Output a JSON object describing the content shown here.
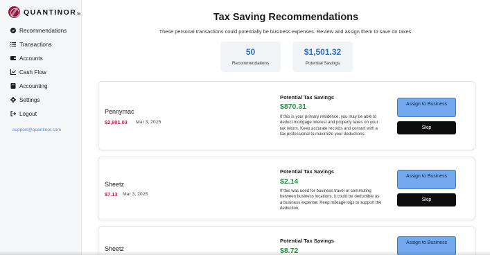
{
  "brand": {
    "name": "QUANTINOR",
    "suffix": "fc"
  },
  "sidebar": {
    "items": [
      {
        "label": "Recommendations",
        "icon": "check-circle-icon"
      },
      {
        "label": "Transactions",
        "icon": "list-icon"
      },
      {
        "label": "Accounts",
        "icon": "wallet-icon"
      },
      {
        "label": "Cash Flow",
        "icon": "line-chart-icon"
      },
      {
        "label": "Accounting",
        "icon": "book-icon"
      },
      {
        "label": "Settings",
        "icon": "gear-icon"
      },
      {
        "label": "Logout",
        "icon": "logout-icon"
      }
    ],
    "support_email": "support@quantinor.com"
  },
  "header": {
    "title": "Tax Saving Recommendations",
    "subtitle": "These personal transactions could potentially be business expenses. Review and assign them to save on taxes."
  },
  "stats": [
    {
      "value": "50",
      "label": "Recommendations"
    },
    {
      "value": "$1,501.32",
      "label": "Potential Savings"
    }
  ],
  "recommendations": [
    {
      "merchant": "Pennymac",
      "amount": "$2,901.03",
      "date": "Mar 3, 2025",
      "savings_heading": "Potential Tax Savings",
      "savings_value": "$870.31",
      "description": "If this is your primary residence, you may be able to deduct mortgage interest and property taxes on your tax return. Keep accurate records and consult with a tax professional to maximize your deductions.",
      "assign_label": "Assign to Business",
      "skip_label": "Skip"
    },
    {
      "merchant": "Sheetz",
      "amount": "$7.13",
      "date": "Mar 3, 2025",
      "savings_heading": "Potential Tax Savings",
      "savings_value": "$2.14",
      "description": "If this was used for business travel or commuting between business locations, it could be deductible as a business expense. Keep mileage logs to support the deduction.",
      "assign_label": "Assign to Business",
      "skip_label": "Skip"
    },
    {
      "merchant": "Sheetz",
      "savings_heading": "Potential Tax Savings",
      "savings_value": "$8.72",
      "assign_label": "Assign to Business"
    }
  ],
  "colors": {
    "brand": "#8e1b3a",
    "amount": "#b3294e",
    "savings": "#23913f",
    "stat_value": "#2f6fb8",
    "assign_button": "#74a9f0",
    "skip_button": "#0d0d0d",
    "support_link": "#5b8fd6"
  }
}
